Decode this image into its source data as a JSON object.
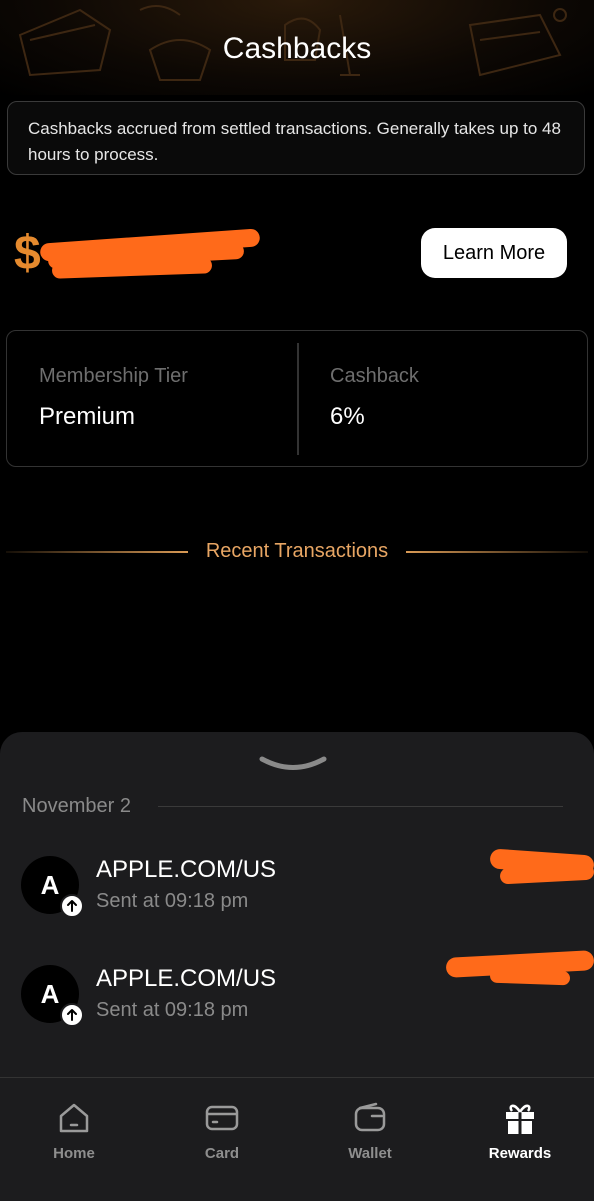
{
  "header": {
    "title": "Cashbacks"
  },
  "info": {
    "text": "Cashbacks accrued from settled transactions. Generally takes up to 48 hours to process."
  },
  "balance": {
    "currency_symbol": "$",
    "redacted": true
  },
  "learn_more": {
    "label": "Learn More"
  },
  "membership": {
    "tier_label": "Membership Tier",
    "tier_value": "Premium",
    "cashback_label": "Cashback",
    "cashback_value": "6%"
  },
  "recent": {
    "label": "Recent Transactions"
  },
  "transactions": {
    "date": "November 2",
    "items": [
      {
        "avatar": "A",
        "name": "APPLE.COM/US",
        "subtitle": "Sent at 09:18 pm",
        "direction_icon": "arrow-up-icon"
      },
      {
        "avatar": "A",
        "name": "APPLE.COM/US",
        "subtitle": "Sent at 09:18 pm",
        "direction_icon": "arrow-up-icon"
      }
    ]
  },
  "tabbar": {
    "tabs": [
      {
        "label": "Home",
        "icon": "home-icon",
        "active": false
      },
      {
        "label": "Card",
        "icon": "card-icon",
        "active": false
      },
      {
        "label": "Wallet",
        "icon": "wallet-icon",
        "active": false
      },
      {
        "label": "Rewards",
        "icon": "gift-icon",
        "active": true
      }
    ]
  },
  "colors": {
    "accent_orange": "#e58a2e",
    "recent_gold": "#e8a664",
    "sheet_bg": "#1c1c1e",
    "redaction": "#ff6a1a"
  }
}
